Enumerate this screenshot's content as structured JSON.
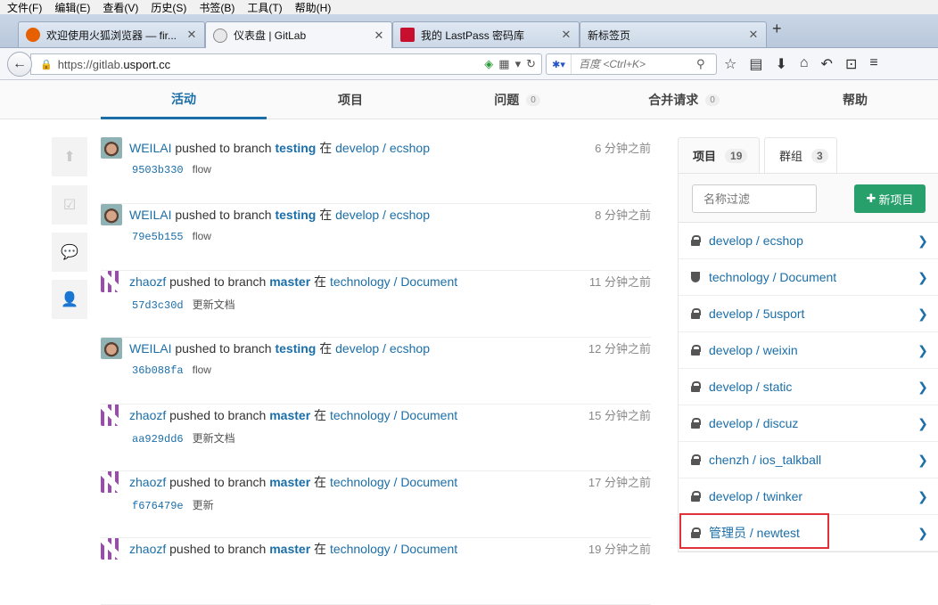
{
  "menu": [
    "文件(F)",
    "编辑(E)",
    "查看(V)",
    "历史(S)",
    "书签(B)",
    "工具(T)",
    "帮助(H)"
  ],
  "tabs": [
    {
      "title": "欢迎使用火狐浏览器 — fir...",
      "icon": "firefox-icon",
      "icon_color": "#e66000"
    },
    {
      "title": "仪表盘 | GitLab",
      "icon": "gitlab-icon",
      "icon_color": "#e8e8e8"
    },
    {
      "title": "我的 LastPass 密码库",
      "icon": "lastpass-icon",
      "icon_color": "#c8102e"
    },
    {
      "title": "新标签页",
      "icon": "",
      "icon_color": ""
    }
  ],
  "newtab": "+",
  "url": {
    "scheme": "https://gitlab.",
    "host": "usport.cc"
  },
  "search": {
    "placeholder": "百度 <Ctrl+K>"
  },
  "gitlab_nav": [
    {
      "label": "活动",
      "count": ""
    },
    {
      "label": "项目",
      "count": ""
    },
    {
      "label": "问题",
      "count": "0"
    },
    {
      "label": "合并请求",
      "count": "0"
    },
    {
      "label": "帮助",
      "count": ""
    }
  ],
  "events": [
    {
      "author": "WEILAI",
      "action": "pushed to branch",
      "branch": "testing",
      "in": "在",
      "project": "develop / ecshop",
      "time": "6 分钟之前",
      "sha": "9503b330",
      "message": "flow",
      "avatar": "face"
    },
    {
      "author": "WEILAI",
      "action": "pushed to branch",
      "branch": "testing",
      "in": "在",
      "project": "develop / ecshop",
      "time": "8 分钟之前",
      "sha": "79e5b155",
      "message": "flow",
      "avatar": "face"
    },
    {
      "author": "zhaozf",
      "action": "pushed to branch",
      "branch": "master",
      "in": "在",
      "project": "technology / Document",
      "time": "11 分钟之前",
      "sha": "57d3c30d",
      "message": "更新文档",
      "avatar": "pattern"
    },
    {
      "author": "WEILAI",
      "action": "pushed to branch",
      "branch": "testing",
      "in": "在",
      "project": "develop / ecshop",
      "time": "12 分钟之前",
      "sha": "36b088fa",
      "message": "flow",
      "avatar": "face"
    },
    {
      "author": "zhaozf",
      "action": "pushed to branch",
      "branch": "master",
      "in": "在",
      "project": "technology / Document",
      "time": "15 分钟之前",
      "sha": "aa929dd6",
      "message": "更新文档",
      "avatar": "pattern"
    },
    {
      "author": "zhaozf",
      "action": "pushed to branch",
      "branch": "master",
      "in": "在",
      "project": "technology / Document",
      "time": "17 分钟之前",
      "sha": "f676479e",
      "message": "更新",
      "avatar": "pattern"
    },
    {
      "author": "zhaozf",
      "action": "pushed to branch",
      "branch": "master",
      "in": "在",
      "project": "technology / Document",
      "time": "19 分钟之前",
      "sha": "",
      "message": "",
      "avatar": "pattern"
    }
  ],
  "panel": {
    "tabs": [
      {
        "label": "项目",
        "count": "19"
      },
      {
        "label": "群组",
        "count": "3"
      }
    ],
    "filter_placeholder": "名称过滤",
    "new_label": "新项目",
    "projects": [
      {
        "name": "develop / ecshop",
        "icon": "lock"
      },
      {
        "name": "technology / Document",
        "icon": "shield"
      },
      {
        "name": "develop / 5usport",
        "icon": "lock"
      },
      {
        "name": "develop / weixin",
        "icon": "lock"
      },
      {
        "name": "develop / static",
        "icon": "lock"
      },
      {
        "name": "develop / discuz",
        "icon": "lock"
      },
      {
        "name": "chenzh / ios_talkball",
        "icon": "lock"
      },
      {
        "name": "develop / twinker",
        "icon": "lock"
      },
      {
        "name": "管理员 / newtest",
        "icon": "lock"
      }
    ]
  },
  "colors": {
    "link": "#1b6ea8",
    "new_button": "#28a06c",
    "highlight": "#e0313a"
  }
}
